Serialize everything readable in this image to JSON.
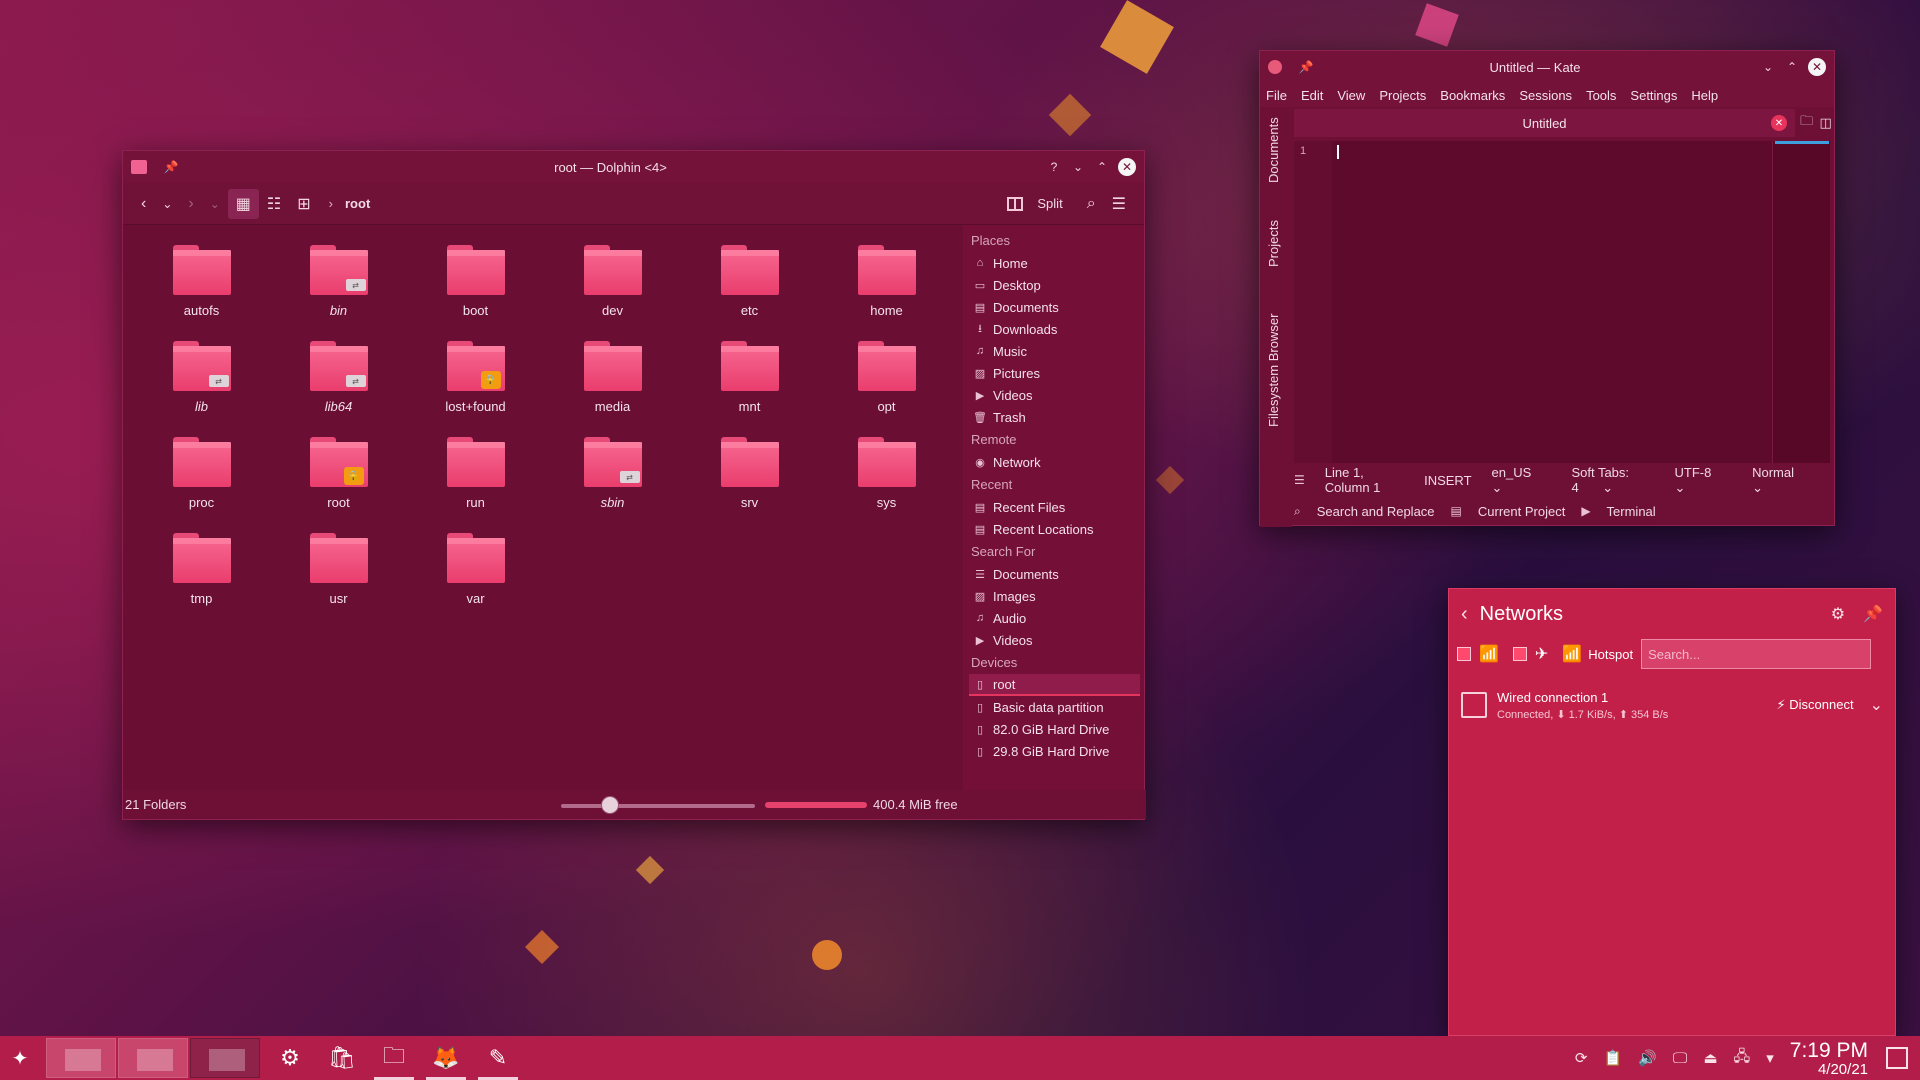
{
  "dolphin": {
    "title": "root — Dolphin <4>",
    "breadcrumb": "root",
    "split_label": "Split",
    "folders": [
      {
        "name": "autofs",
        "badge": ""
      },
      {
        "name": "bin",
        "badge": "link"
      },
      {
        "name": "boot",
        "badge": ""
      },
      {
        "name": "dev",
        "badge": ""
      },
      {
        "name": "etc",
        "badge": ""
      },
      {
        "name": "home",
        "badge": ""
      },
      {
        "name": "lib",
        "badge": "link"
      },
      {
        "name": "lib64",
        "badge": "link"
      },
      {
        "name": "lost+found",
        "badge": "lock"
      },
      {
        "name": "media",
        "badge": ""
      },
      {
        "name": "mnt",
        "badge": ""
      },
      {
        "name": "opt",
        "badge": ""
      },
      {
        "name": "proc",
        "badge": ""
      },
      {
        "name": "root",
        "badge": "lock"
      },
      {
        "name": "run",
        "badge": ""
      },
      {
        "name": "sbin",
        "badge": "link"
      },
      {
        "name": "srv",
        "badge": ""
      },
      {
        "name": "sys",
        "badge": ""
      },
      {
        "name": "tmp",
        "badge": ""
      },
      {
        "name": "usr",
        "badge": ""
      },
      {
        "name": "var",
        "badge": ""
      }
    ],
    "places": {
      "places_header": "Places",
      "places": [
        "Home",
        "Desktop",
        "Documents",
        "Downloads",
        "Music",
        "Pictures",
        "Videos",
        "Trash"
      ],
      "remote_header": "Remote",
      "remote": [
        "Network"
      ],
      "recent_header": "Recent",
      "recent": [
        "Recent Files",
        "Recent Locations"
      ],
      "search_header": "Search For",
      "search": [
        "Documents",
        "Images",
        "Audio",
        "Videos"
      ],
      "devices_header": "Devices",
      "devices": [
        "root",
        "Basic data partition",
        "82.0 GiB Hard Drive",
        "29.8 GiB Hard Drive"
      ]
    },
    "status": {
      "count": "21 Folders",
      "free": "400.4 MiB free"
    }
  },
  "kate": {
    "title": "Untitled — Kate",
    "menu": [
      "File",
      "Edit",
      "View",
      "Projects",
      "Bookmarks",
      "Sessions",
      "Tools",
      "Settings",
      "Help"
    ],
    "side_tabs": [
      "Documents",
      "Projects",
      "Filesystem Browser"
    ],
    "doc_tab": "Untitled",
    "line_number": "1",
    "status": {
      "position": "Line 1, Column 1",
      "mode": "INSERT",
      "language": "en_US",
      "indent": "Soft Tabs: 4",
      "encoding": "UTF-8",
      "input_mode": "Normal"
    },
    "bottom_tools": [
      "Search and Replace",
      "Current Project",
      "Terminal"
    ]
  },
  "networks": {
    "title": "Networks",
    "hotspot_label": "Hotspot",
    "search_placeholder": "Search...",
    "connection": {
      "name": "Wired connection 1",
      "detail": "Connected, ⬇ 1.7 KiB/s, ⬆ 354 B/s",
      "action": "Disconnect"
    }
  },
  "taskbar": {
    "time": "7:19 PM",
    "date": "4/20/21"
  }
}
